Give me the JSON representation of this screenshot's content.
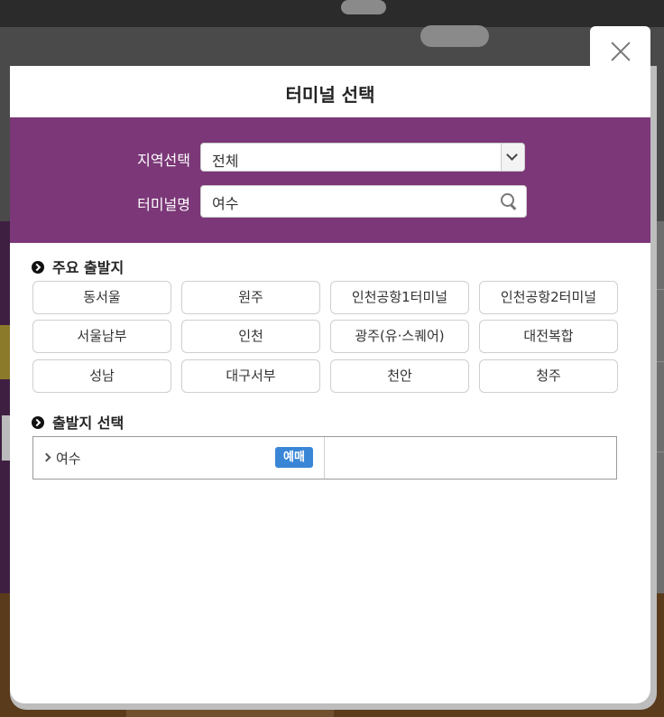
{
  "modal": {
    "title": "터미널 선택"
  },
  "filters": {
    "region_label": "지역선택",
    "region_value": "전체",
    "terminal_label": "터미널명",
    "terminal_value": "여수"
  },
  "major": {
    "heading": "주요 출발지",
    "items": [
      "동서울",
      "원주",
      "인천공항1터미널",
      "인천공항2터미널",
      "서울남부",
      "인천",
      "광주(유·스퀘어)",
      "대전복합",
      "성남",
      "대구서부",
      "천안",
      "청주"
    ]
  },
  "departure": {
    "heading": "출발지 선택",
    "results": [
      {
        "name": "여수",
        "badge": "예매"
      }
    ]
  },
  "colors": {
    "accent_purple": "#7b3777",
    "badge_blue": "#3a86d6"
  }
}
